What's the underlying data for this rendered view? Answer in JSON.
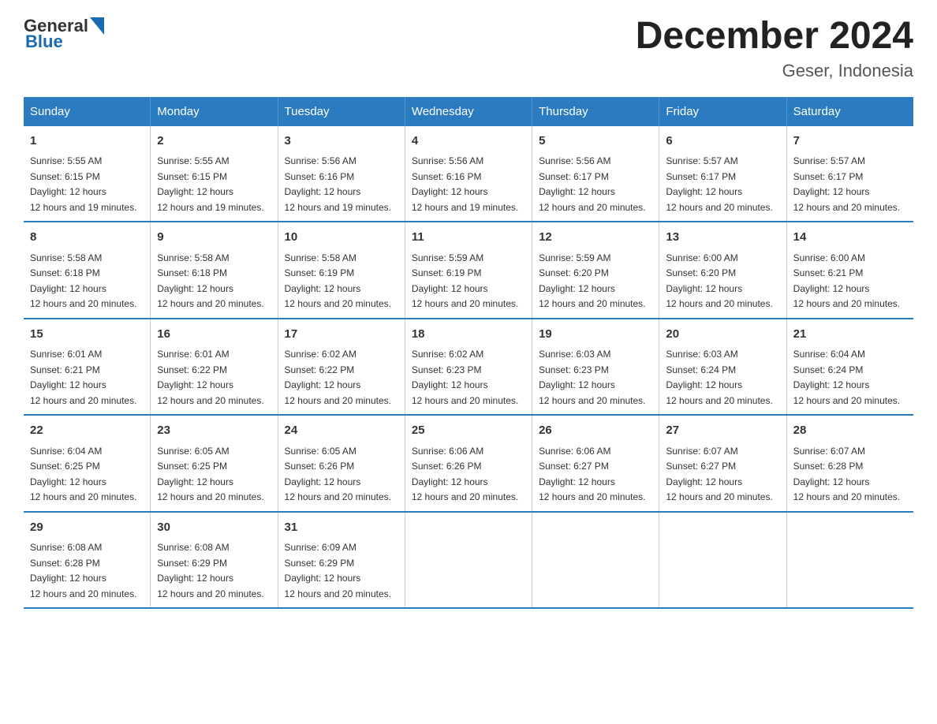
{
  "logo": {
    "general": "General",
    "blue": "Blue"
  },
  "header": {
    "month_year": "December 2024",
    "location": "Geser, Indonesia"
  },
  "days_of_week": [
    "Sunday",
    "Monday",
    "Tuesday",
    "Wednesday",
    "Thursday",
    "Friday",
    "Saturday"
  ],
  "weeks": [
    [
      {
        "day": "1",
        "sunrise": "5:55 AM",
        "sunset": "6:15 PM",
        "daylight": "12 hours and 19 minutes."
      },
      {
        "day": "2",
        "sunrise": "5:55 AM",
        "sunset": "6:15 PM",
        "daylight": "12 hours and 19 minutes."
      },
      {
        "day": "3",
        "sunrise": "5:56 AM",
        "sunset": "6:16 PM",
        "daylight": "12 hours and 19 minutes."
      },
      {
        "day": "4",
        "sunrise": "5:56 AM",
        "sunset": "6:16 PM",
        "daylight": "12 hours and 19 minutes."
      },
      {
        "day": "5",
        "sunrise": "5:56 AM",
        "sunset": "6:17 PM",
        "daylight": "12 hours and 20 minutes."
      },
      {
        "day": "6",
        "sunrise": "5:57 AM",
        "sunset": "6:17 PM",
        "daylight": "12 hours and 20 minutes."
      },
      {
        "day": "7",
        "sunrise": "5:57 AM",
        "sunset": "6:17 PM",
        "daylight": "12 hours and 20 minutes."
      }
    ],
    [
      {
        "day": "8",
        "sunrise": "5:58 AM",
        "sunset": "6:18 PM",
        "daylight": "12 hours and 20 minutes."
      },
      {
        "day": "9",
        "sunrise": "5:58 AM",
        "sunset": "6:18 PM",
        "daylight": "12 hours and 20 minutes."
      },
      {
        "day": "10",
        "sunrise": "5:58 AM",
        "sunset": "6:19 PM",
        "daylight": "12 hours and 20 minutes."
      },
      {
        "day": "11",
        "sunrise": "5:59 AM",
        "sunset": "6:19 PM",
        "daylight": "12 hours and 20 minutes."
      },
      {
        "day": "12",
        "sunrise": "5:59 AM",
        "sunset": "6:20 PM",
        "daylight": "12 hours and 20 minutes."
      },
      {
        "day": "13",
        "sunrise": "6:00 AM",
        "sunset": "6:20 PM",
        "daylight": "12 hours and 20 minutes."
      },
      {
        "day": "14",
        "sunrise": "6:00 AM",
        "sunset": "6:21 PM",
        "daylight": "12 hours and 20 minutes."
      }
    ],
    [
      {
        "day": "15",
        "sunrise": "6:01 AM",
        "sunset": "6:21 PM",
        "daylight": "12 hours and 20 minutes."
      },
      {
        "day": "16",
        "sunrise": "6:01 AM",
        "sunset": "6:22 PM",
        "daylight": "12 hours and 20 minutes."
      },
      {
        "day": "17",
        "sunrise": "6:02 AM",
        "sunset": "6:22 PM",
        "daylight": "12 hours and 20 minutes."
      },
      {
        "day": "18",
        "sunrise": "6:02 AM",
        "sunset": "6:23 PM",
        "daylight": "12 hours and 20 minutes."
      },
      {
        "day": "19",
        "sunrise": "6:03 AM",
        "sunset": "6:23 PM",
        "daylight": "12 hours and 20 minutes."
      },
      {
        "day": "20",
        "sunrise": "6:03 AM",
        "sunset": "6:24 PM",
        "daylight": "12 hours and 20 minutes."
      },
      {
        "day": "21",
        "sunrise": "6:04 AM",
        "sunset": "6:24 PM",
        "daylight": "12 hours and 20 minutes."
      }
    ],
    [
      {
        "day": "22",
        "sunrise": "6:04 AM",
        "sunset": "6:25 PM",
        "daylight": "12 hours and 20 minutes."
      },
      {
        "day": "23",
        "sunrise": "6:05 AM",
        "sunset": "6:25 PM",
        "daylight": "12 hours and 20 minutes."
      },
      {
        "day": "24",
        "sunrise": "6:05 AM",
        "sunset": "6:26 PM",
        "daylight": "12 hours and 20 minutes."
      },
      {
        "day": "25",
        "sunrise": "6:06 AM",
        "sunset": "6:26 PM",
        "daylight": "12 hours and 20 minutes."
      },
      {
        "day": "26",
        "sunrise": "6:06 AM",
        "sunset": "6:27 PM",
        "daylight": "12 hours and 20 minutes."
      },
      {
        "day": "27",
        "sunrise": "6:07 AM",
        "sunset": "6:27 PM",
        "daylight": "12 hours and 20 minutes."
      },
      {
        "day": "28",
        "sunrise": "6:07 AM",
        "sunset": "6:28 PM",
        "daylight": "12 hours and 20 minutes."
      }
    ],
    [
      {
        "day": "29",
        "sunrise": "6:08 AM",
        "sunset": "6:28 PM",
        "daylight": "12 hours and 20 minutes."
      },
      {
        "day": "30",
        "sunrise": "6:08 AM",
        "sunset": "6:29 PM",
        "daylight": "12 hours and 20 minutes."
      },
      {
        "day": "31",
        "sunrise": "6:09 AM",
        "sunset": "6:29 PM",
        "daylight": "12 hours and 20 minutes."
      },
      null,
      null,
      null,
      null
    ]
  ]
}
